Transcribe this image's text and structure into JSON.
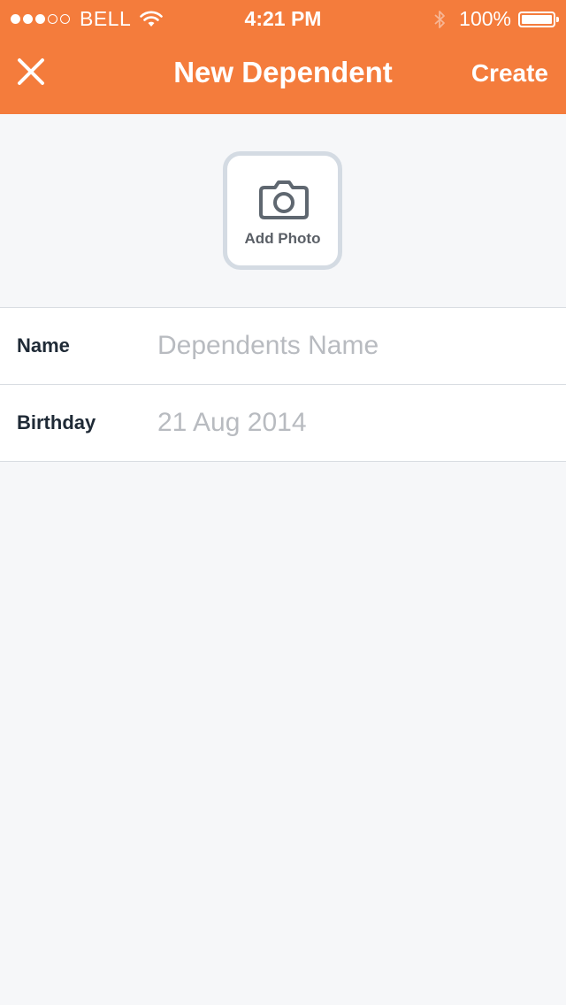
{
  "status_bar": {
    "carrier": "BELL",
    "time": "4:21 PM",
    "battery_percent": "100%",
    "signal_bars": [
      true,
      true,
      true,
      false,
      false
    ]
  },
  "nav": {
    "title": "New Dependent",
    "create_label": "Create"
  },
  "photo": {
    "label": "Add Photo"
  },
  "form": {
    "name_label": "Name",
    "name_placeholder": "Dependents Name",
    "name_value": "",
    "birthday_label": "Birthday",
    "birthday_value": "21 Aug 2014"
  },
  "colors": {
    "accent": "#f47c3c",
    "background": "#f6f7f9",
    "placeholder": "#b8bbc0",
    "label": "#1f2a36"
  },
  "icons": [
    "signal-icon",
    "wifi-icon",
    "bluetooth-icon",
    "battery-icon",
    "close-icon",
    "camera-icon"
  ]
}
